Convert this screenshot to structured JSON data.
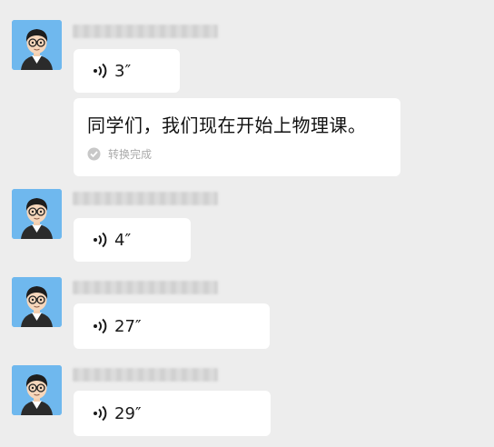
{
  "messages": [
    {
      "type": "voice",
      "duration": "3″",
      "sender_name": ""
    },
    {
      "type": "voice",
      "duration": "4″",
      "sender_name": ""
    },
    {
      "type": "voice",
      "duration": "27″",
      "sender_name": ""
    },
    {
      "type": "voice",
      "duration": "29″",
      "sender_name": ""
    }
  ],
  "transcription": {
    "text": "同学们，我们现在开始上物理课。",
    "status": "转换完成"
  },
  "colors": {
    "background": "#ededed",
    "bubble": "#ffffff",
    "avatar": "#6fb8ee"
  },
  "icons": {
    "voice": "voice-wave-icon",
    "status": "check-circle-icon",
    "avatar": "cartoon-man-with-glasses-avatar"
  }
}
